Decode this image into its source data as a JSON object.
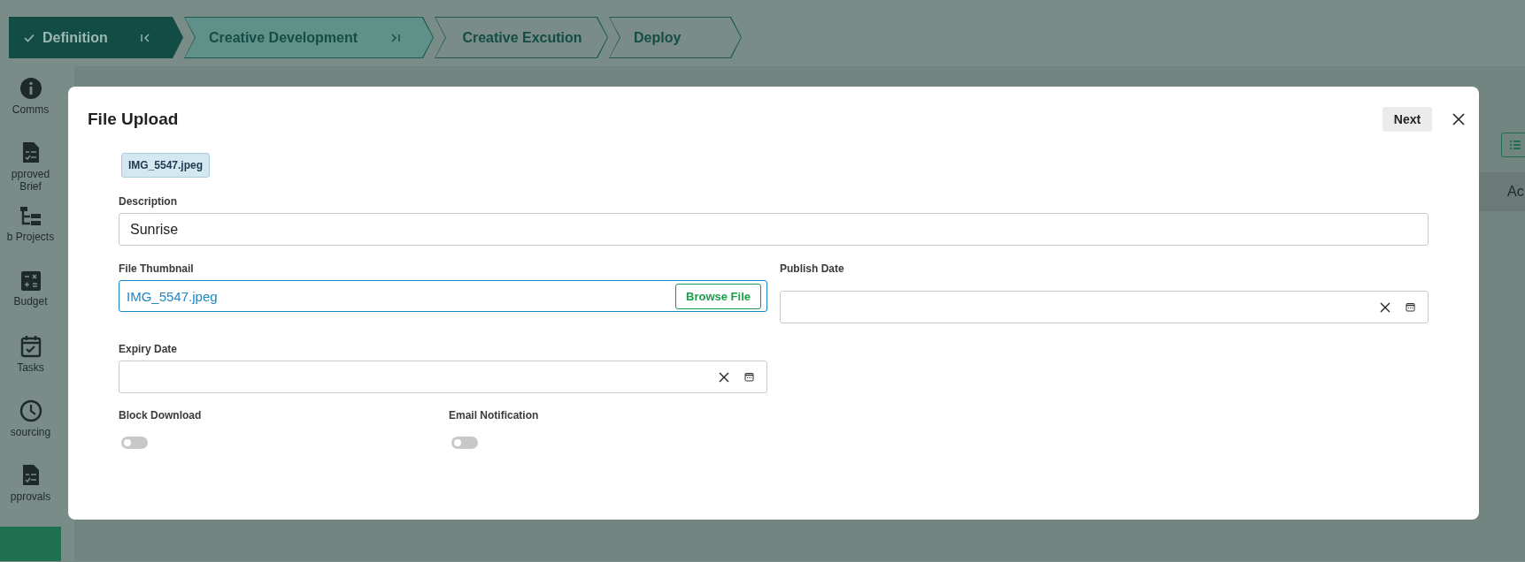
{
  "stepper": [
    {
      "label": "Definition",
      "completed": true,
      "selected": false
    },
    {
      "label": "Creative Development",
      "completed": false,
      "selected": true
    },
    {
      "label": "Creative Excution",
      "completed": false,
      "selected": false
    },
    {
      "label": "Deploy",
      "completed": false,
      "selected": false
    }
  ],
  "sidebar": {
    "items": [
      {
        "label": "Comms",
        "selected": false
      },
      {
        "label": "pproved Brief",
        "selected": false
      },
      {
        "label": "b Projects",
        "selected": false
      },
      {
        "label": "Budget",
        "selected": false
      },
      {
        "label": "Tasks",
        "selected": false
      },
      {
        "label": "sourcing",
        "selected": false
      },
      {
        "label": "pprovals",
        "selected": false
      },
      {
        "selected": true
      }
    ]
  },
  "main": {
    "table": {
      "columns": [
        "Ac"
      ]
    }
  },
  "modal": {
    "title": "File Upload",
    "next_button": "Next",
    "file_chip": "IMG_5547.jpeg",
    "description": {
      "label": "Description",
      "value": "Sunrise"
    },
    "thumbnail": {
      "label": "File Thumbnail",
      "value": "IMG_5547.jpeg",
      "button": "Browse File"
    },
    "publish_date": {
      "label": "Publish Date"
    },
    "expiry_date": {
      "label": "Expiry Date"
    },
    "toggles": [
      {
        "label": "Block Download",
        "on": false
      },
      {
        "label": "Email Notification",
        "on": false
      }
    ]
  }
}
